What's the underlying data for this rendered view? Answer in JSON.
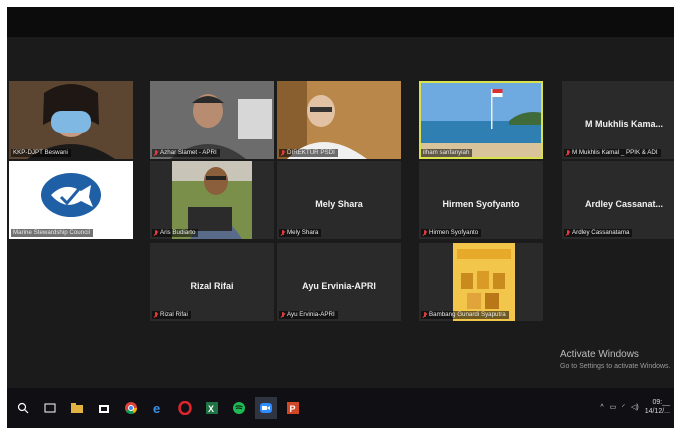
{
  "window": {
    "title": ""
  },
  "participants": [
    {
      "name": "",
      "label": "KKP-DJPT Beswani",
      "type": "video",
      "muted": false
    },
    {
      "name": "",
      "label": "Azhar Slamet - APRI",
      "type": "video",
      "muted": true
    },
    {
      "name": "",
      "label": "DIREKTUR PSDI",
      "type": "video",
      "muted": true
    },
    {
      "name": "",
      "label": "ilham sanfanyiah",
      "type": "video",
      "muted": false,
      "active": true
    },
    {
      "name": "M Mukhlis Kama...",
      "label": "M Mukhlis Kamal _ PPIK & ADI",
      "type": "name",
      "muted": true
    },
    {
      "name": "",
      "label": "Marine Stewardship Council",
      "type": "logo",
      "muted": false
    },
    {
      "name": "",
      "label": "Aris Budiarto",
      "type": "video",
      "muted": true
    },
    {
      "name": "Mely Shara",
      "label": "Mely Shara",
      "type": "name",
      "muted": true
    },
    {
      "name": "Hirmen Syofyanto",
      "label": "Hirmen Syofyanto",
      "type": "name",
      "muted": true
    },
    {
      "name": "Ardley Cassanat...",
      "label": "Ardley Cassanatama",
      "type": "name",
      "muted": true
    },
    {
      "name": "Rizal Rifai",
      "label": "Rizal Rifai",
      "type": "name",
      "muted": true
    },
    {
      "name": "Ayu Ervinia-APRI",
      "label": "Ayu Ervinia-APRI",
      "type": "name",
      "muted": true
    },
    {
      "name": "",
      "label": "Bambang Gunardi Syaputra",
      "type": "image",
      "muted": true
    }
  ],
  "watermark": {
    "title": "Activate Windows",
    "subtitle": "Go to Settings to activate Windows."
  },
  "taskbar": {
    "apps": [
      "search-icon",
      "task-view-icon",
      "file-explorer-icon",
      "store-icon",
      "chrome-icon",
      "edge-icon",
      "opera-icon",
      "excel-icon",
      "spotify-icon",
      "zoom-icon",
      "powerpoint-icon"
    ],
    "tray_time": "09:__",
    "tray_date": "14/12/..."
  },
  "colors": {
    "active_border": "#d9e24a",
    "muted_icon": "#e23b3b",
    "zoom_blue": "#2d8cff"
  }
}
